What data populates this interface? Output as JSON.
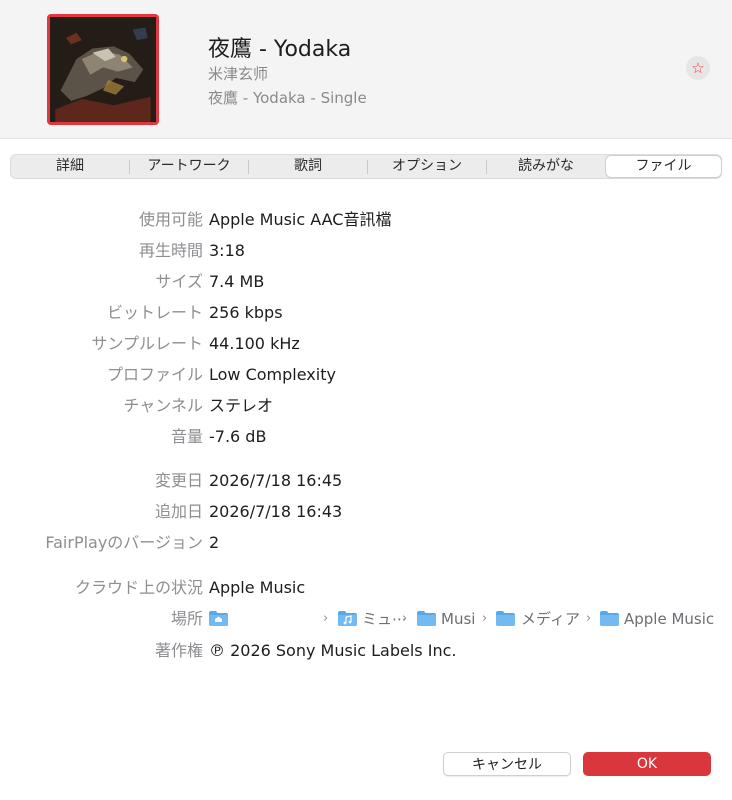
{
  "header": {
    "title": "夜鷹 - Yodaka",
    "artist": "米津玄师",
    "album": "夜鷹 - Yodaka - Single",
    "favorite_icon": "☆"
  },
  "tabs": [
    {
      "label": "詳細"
    },
    {
      "label": "アートワーク"
    },
    {
      "label": "歌詞"
    },
    {
      "label": "オプション"
    },
    {
      "label": "読みがな"
    },
    {
      "label": "ファイル",
      "selected": true
    }
  ],
  "file_info": {
    "kind": {
      "label": "使用可能",
      "value": "Apple Music AAC音訊檔"
    },
    "duration": {
      "label": "再生時間",
      "value": "3:18"
    },
    "size": {
      "label": "サイズ",
      "value": "7.4 MB"
    },
    "bitrate": {
      "label": "ビットレート",
      "value": "256 kbps"
    },
    "sample_rate": {
      "label": "サンプルレート",
      "value": "44.100 kHz"
    },
    "profile": {
      "label": "プロファイル",
      "value": "Low Complexity"
    },
    "channels": {
      "label": "チャンネル",
      "value": "ステレオ"
    },
    "volume": {
      "label": "音量",
      "value": "-7.6 dB"
    },
    "modified": {
      "label": "変更日",
      "value": "2026/7/18 16:45"
    },
    "added": {
      "label": "追加日",
      "value": "2026/7/18 16:43"
    },
    "fairplay": {
      "label": "FairPlayのバージョン",
      "value": "2"
    },
    "cloud_status": {
      "label": "クラウド上の状況",
      "value": "Apple Music"
    },
    "location": {
      "label": "場所",
      "crumbs": [
        "ミュ⋯",
        "Musi",
        "メディア",
        "Apple Music"
      ],
      "separator": "›"
    },
    "copyright": {
      "label": "著作権",
      "value": "℗ 2026 Sony Music Labels Inc."
    }
  },
  "buttons": {
    "cancel": "キャンセル",
    "ok": "OK"
  },
  "colors": {
    "accent": "#d9373d",
    "folder": "#5aa9e6"
  },
  "icons": {
    "favorite": "star-icon",
    "home_folder": "home-folder-icon",
    "music_folder": "music-folder-icon",
    "folder": "folder-icon"
  }
}
